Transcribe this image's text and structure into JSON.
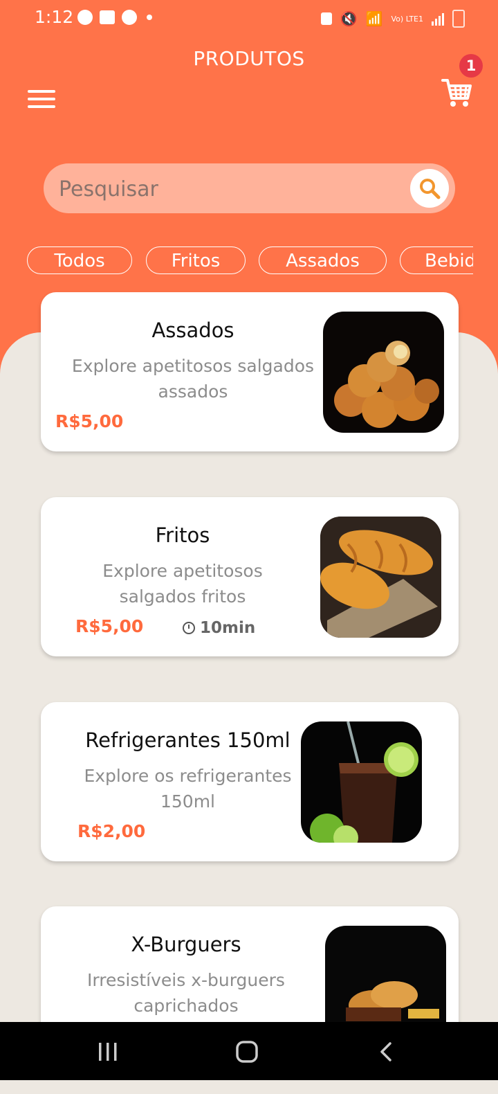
{
  "status_bar": {
    "time": "1:12",
    "network": "Vo) LTE1"
  },
  "header": {
    "title": "PRODUTOS",
    "cart_count": "1"
  },
  "search": {
    "placeholder": "Pesquisar"
  },
  "chips": [
    "Todos",
    "Fritos",
    "Assados",
    "Bebidas"
  ],
  "products": [
    {
      "name": "Assados",
      "description_line1": "Explore apetitosos salgados",
      "description_line2": "assados",
      "price": "R$5,00",
      "time": ""
    },
    {
      "name": "Fritos",
      "description_line1": "Explore apetitosos",
      "description_line2": "salgados fritos",
      "price": "R$5,00",
      "time": "10min"
    },
    {
      "name": "Refrigerantes 150ml",
      "description_line1": "Explore os refrigerantes",
      "description_line2": "150ml",
      "price": "R$2,00",
      "time": ""
    },
    {
      "name": "X-Burguers",
      "description_line1": "Irresistíveis x-burguers",
      "description_line2": "caprichados",
      "price": "",
      "time": ""
    }
  ],
  "colors": {
    "accent": "#ff7349",
    "price": "#ff6a3d",
    "background": "#ede8e1",
    "badge": "#e63946"
  }
}
